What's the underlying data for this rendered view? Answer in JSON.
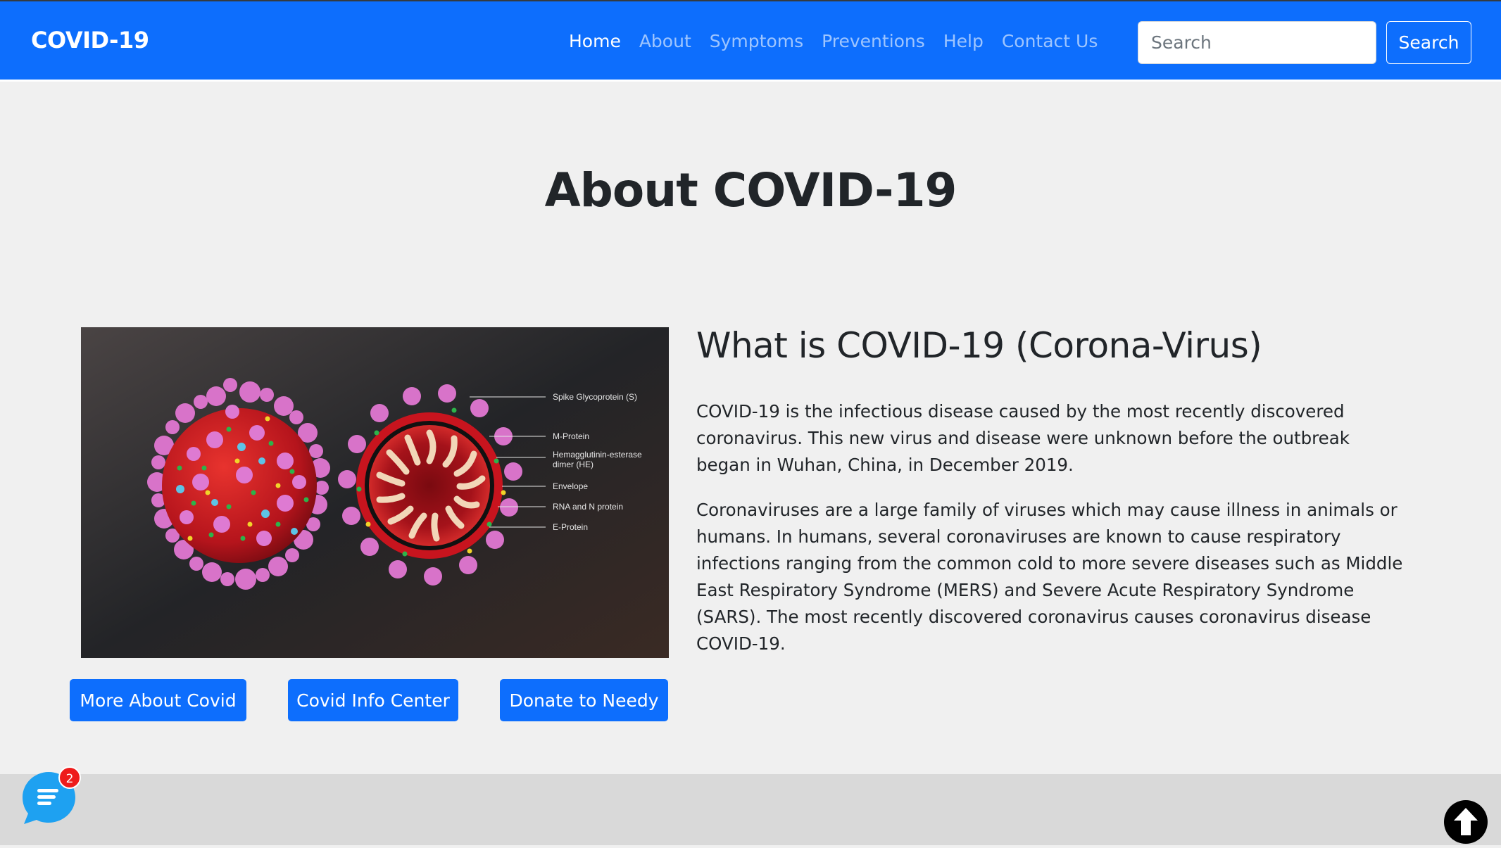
{
  "navbar": {
    "brand": "COVID-19",
    "links": [
      {
        "label": "Home",
        "active": true
      },
      {
        "label": "About",
        "active": false
      },
      {
        "label": "Symptoms",
        "active": false
      },
      {
        "label": "Preventions",
        "active": false
      },
      {
        "label": "Help",
        "active": false
      },
      {
        "label": "Contact Us",
        "active": false
      }
    ],
    "search_placeholder": "Search",
    "search_button": "Search"
  },
  "main": {
    "title": "About COVID-19",
    "section_title": "What is COVID-19 (Corona-Virus)",
    "paragraphs": [
      "COVID-19 is the infectious disease caused by the most recently discovered coronavirus. This new virus and disease were unknown before the outbreak began in Wuhan, China, in December 2019.",
      "Coronaviruses are a large family of viruses which may cause illness in animals or humans. In humans, several coronaviruses are known to cause respiratory infections ranging from the common cold to more severe diseases such as Middle East Respiratory Syndrome (MERS) and Severe Acute Respiratory Syndrome (SARS). The most recently discovered coronavirus causes coronavirus disease COVID-19."
    ],
    "image_labels": [
      "Spike Glycoprotein (S)",
      "M-Protein",
      "Hemagglutinin-esterase",
      "dimer (HE)",
      "Envelope",
      "RNA and N protein",
      "E-Protein"
    ],
    "buttons": [
      "More About Covid",
      "Covid Info Center",
      "Donate to Needy"
    ]
  },
  "widgets": {
    "chat_badge_count": "2",
    "chat_icon": "chat-bubble-icon",
    "scroll_icon": "arrow-up-circle-icon"
  },
  "colors": {
    "primary": "#0d6efd",
    "page_background": "#f0f0f0",
    "footer_background": "#d9d9d9",
    "chat_widget": "#1ea1f1",
    "badge": "#ee1c1c"
  }
}
